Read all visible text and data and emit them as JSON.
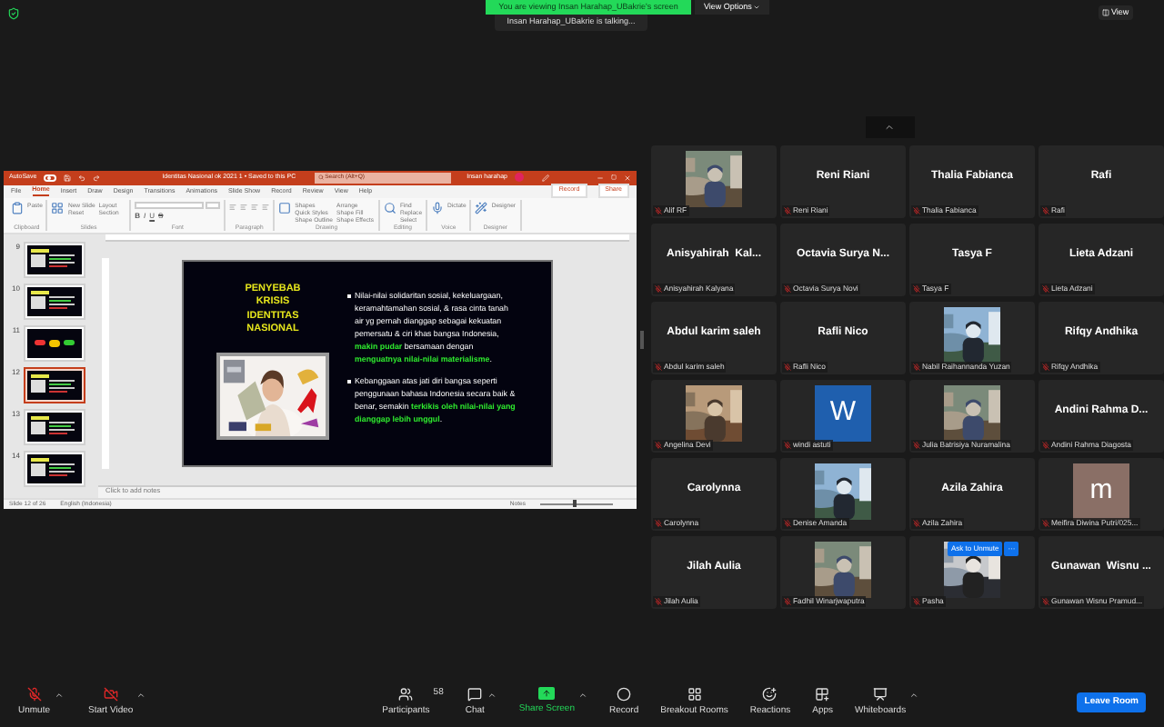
{
  "top_bar": {
    "viewing_banner": "You are viewing Insan Harahap_UBakrie's screen",
    "view_options": "View Options",
    "talking": "Insan Harahap_UBakrie is talking...",
    "view_button": "View"
  },
  "powerpoint": {
    "autosave": "AutoSave",
    "autosave_on": false,
    "zoom": {
      "level": 0.45
    },
    "doc_title": "Identitas Nasional ok 2021 1 • Saved to this PC",
    "search": "Search (Alt+Q)",
    "user": "Insan harahap",
    "tabs": [
      {
        "label": "File",
        "selected": false
      },
      {
        "label": "Home",
        "selected": true
      },
      {
        "label": "Insert",
        "selected": false
      },
      {
        "label": "Draw",
        "selected": false
      },
      {
        "label": "Design",
        "selected": false
      },
      {
        "label": "Transitions",
        "selected": false
      },
      {
        "label": "Animations",
        "selected": false
      },
      {
        "label": "Slide Show",
        "selected": false
      },
      {
        "label": "Record",
        "selected": false
      },
      {
        "label": "Review",
        "selected": false
      },
      {
        "label": "View",
        "selected": false
      },
      {
        "label": "Help",
        "selected": false
      }
    ],
    "record_button": "Record",
    "share_button": "Share",
    "ribbon_groups": [
      {
        "label": "Clipboard",
        "buttons": [
          "Paste"
        ]
      },
      {
        "label": "Slides",
        "buttons": [
          "New Slide",
          "Layout",
          "Reset",
          "Section"
        ]
      },
      {
        "label": "Font",
        "buttons": [
          "B",
          "I",
          "U",
          "S"
        ]
      },
      {
        "label": "Paragraph"
      },
      {
        "label": "Drawing",
        "buttons": [
          "Shapes",
          "Arrange",
          "Quick Styles",
          "Shape Fill",
          "Shape Outline",
          "Shape Effects"
        ]
      },
      {
        "label": "Editing",
        "buttons": [
          "Find",
          "Replace",
          "Select"
        ]
      },
      {
        "label": "Voice",
        "buttons": [
          "Dictate"
        ]
      },
      {
        "label": "Designer",
        "buttons": [
          "Designer"
        ]
      }
    ],
    "slides": [
      {
        "number": "9",
        "selected": false
      },
      {
        "number": "10",
        "selected": false
      },
      {
        "number": "11",
        "selected": false
      },
      {
        "number": "12",
        "selected": true
      },
      {
        "number": "13",
        "selected": false
      },
      {
        "number": "14",
        "selected": false
      }
    ],
    "slide": {
      "title": "PENYEBAB KRISIS IDENTITAS NASIONAL",
      "image": {
        "kind": "picture"
      },
      "bullets": [
        [
          {
            "text": "Nilai-nilai solidaritan sosial, kekeluargaan, keramahtamahan sosial, & rasa cinta tanah air yg pernah dianggap sebagai kekuatan pemersatu & ciri khas bangsa Indonesia, ",
            "highlight": false
          },
          {
            "text": "makin pudar",
            "highlight": true
          },
          {
            "text": " bersamaan dengan ",
            "highlight": false
          },
          {
            "text": "menguatnya nilai-nilai materialisme",
            "highlight": true
          },
          {
            "text": ".",
            "highlight": false
          }
        ],
        [
          {
            "text": "Kebanggaan atas jati diri bangsa seperti penggunaan bahasa Indonesia secara baik & benar, semakin ",
            "highlight": false
          },
          {
            "text": "terkikis oleh nilai-nilai yang dianggap lebih unggul",
            "highlight": true
          },
          {
            "text": ".",
            "highlight": false
          }
        ]
      ]
    },
    "notes_placeholder": "Click to add notes",
    "status": {
      "slide": "Slide 12 of 26",
      "language": "English (Indonesia)",
      "notes": "Notes"
    }
  },
  "gallery": [
    {
      "kind": "picture",
      "label": "Alif RF",
      "muted": true
    },
    {
      "kind": "name",
      "title": "Reni Riani",
      "label": "Reni Riani",
      "muted": true
    },
    {
      "kind": "name",
      "title": "Thalia Fabianca",
      "label": "Thalia Fabianca",
      "muted": true
    },
    {
      "kind": "name",
      "title": "Rafi",
      "label": "Rafi",
      "muted": true
    },
    {
      "kind": "name",
      "title": "Anisyahirah  Kal...",
      "label": "Anisyahirah Kalyana",
      "muted": true
    },
    {
      "kind": "name",
      "title": "Octavia Surya N...",
      "label": "Octavia Surya Novi",
      "muted": true
    },
    {
      "kind": "name",
      "title": "Tasya F",
      "label": "Tasya F",
      "muted": true
    },
    {
      "kind": "name",
      "title": "Lieta Adzani",
      "label": "Lieta Adzani",
      "muted": true
    },
    {
      "kind": "name",
      "title": "Abdul karim saleh",
      "label": "Abdul karim saleh",
      "muted": true
    },
    {
      "kind": "name",
      "title": "Rafli Nico",
      "label": "Rafli Nico",
      "muted": true
    },
    {
      "kind": "picture",
      "label": "Nabil Raihannanda Yuzan",
      "muted": true
    },
    {
      "kind": "name",
      "title": "Rifqy Andhika",
      "label": "Rifqy Andhika",
      "muted": true
    },
    {
      "kind": "picture",
      "label": "Angelina Devi",
      "muted": true
    },
    {
      "kind": "avatar",
      "letter": "W",
      "color": "#1f5fae",
      "label": "windi astuti",
      "muted": true
    },
    {
      "kind": "picture",
      "label": "Julia Batrisiya Nuramalina",
      "muted": true
    },
    {
      "kind": "name",
      "title": "Andini Rahma D...",
      "label": "Andini Rahma Diagosta",
      "muted": true
    },
    {
      "kind": "name",
      "title": "Carolynna",
      "label": "Carolynna",
      "muted": true
    },
    {
      "kind": "picture",
      "label": "Denise Amanda",
      "muted": true
    },
    {
      "kind": "name",
      "title": "Azila Zahira",
      "label": "Azila Zahira",
      "muted": true
    },
    {
      "kind": "avatar",
      "letter": "m",
      "color": "#8a6f66",
      "label": "Meifira Diwina Putri/025...",
      "muted": true
    },
    {
      "kind": "name",
      "title": "Jilah Aulia",
      "label": "Jilah Aulia",
      "muted": true
    },
    {
      "kind": "picture",
      "label": "Fadhil Winarjwaputra",
      "muted": true
    },
    {
      "kind": "picture",
      "label": "Pasha",
      "muted": true,
      "overlay": {
        "ask_button": "Ask to Unmute",
        "more_button": "···"
      }
    },
    {
      "kind": "name",
      "title": "Gunawan  Wisnu ...",
      "label": "Gunawan Wisnu Pramud...",
      "muted": true
    }
  ],
  "toolbar": {
    "unmute": "Unmute",
    "start_video": "Start Video",
    "participants": "Participants",
    "participant_count": "58",
    "chat": "Chat",
    "share_screen": "Share Screen",
    "record": "Record",
    "breakout_rooms": "Breakout Rooms",
    "reactions": "Reactions",
    "apps": "Apps",
    "whiteboards": "Whiteboards",
    "leave": "Leave Room"
  }
}
